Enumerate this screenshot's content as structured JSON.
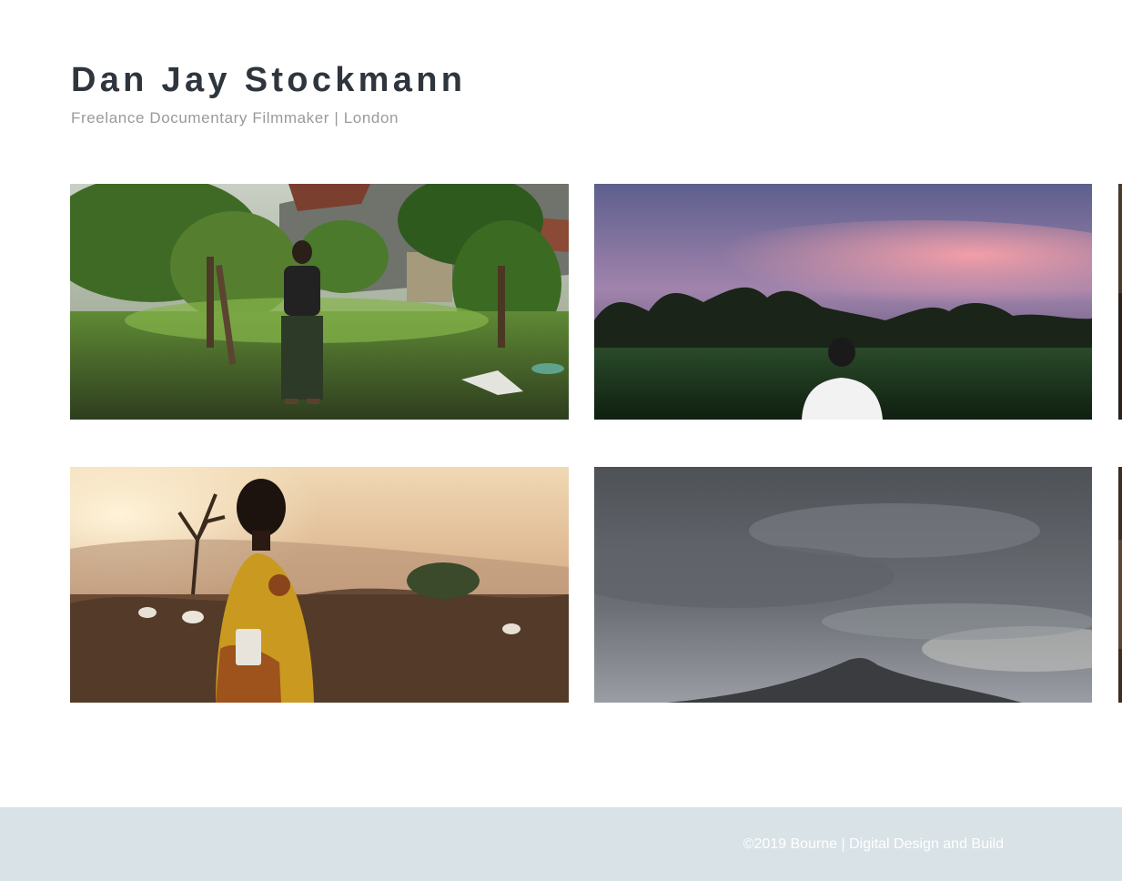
{
  "header": {
    "title": "Dan Jay Stockmann",
    "tagline": "Freelance Documentary Filmmaker | London"
  },
  "gallery": {
    "tiles": [
      {
        "icon": "photo-garden-man",
        "palette": [
          "#3f5a2a",
          "#6c8f3f",
          "#1f2a17"
        ]
      },
      {
        "icon": "photo-sunset-field",
        "palette": [
          "#7e78a8",
          "#e99aa6",
          "#1c3320"
        ]
      },
      {
        "icon": "photo-child-sunset",
        "palette": [
          "#e5c49a",
          "#8b6a4b",
          "#c7a13a"
        ]
      },
      {
        "icon": "photo-mountain-clouds",
        "palette": [
          "#5d6168",
          "#8f949b",
          "#3a3c40"
        ]
      }
    ]
  },
  "footer": {
    "credit": "©2019 Bourne | Digital Design and Build"
  }
}
